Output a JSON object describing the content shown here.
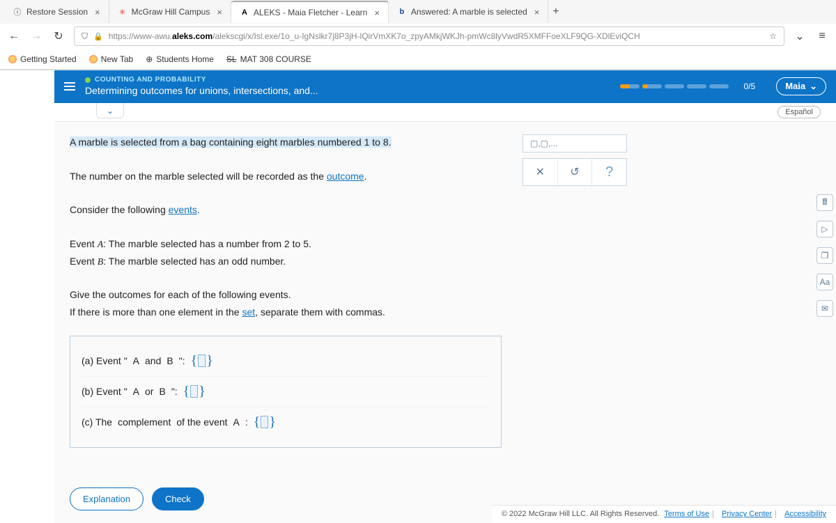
{
  "tabs": [
    {
      "label": "Restore Session",
      "icon": "ⓘ"
    },
    {
      "label": "McGraw Hill Campus",
      "icon": "✳"
    },
    {
      "label": "ALEKS - Maia Fletcher - Learn",
      "icon": "A",
      "active": true
    },
    {
      "label": "Answered: A marble is selected",
      "icon": "b"
    }
  ],
  "url": {
    "host_prefix": "https://www-awu.",
    "host_bold": "aleks.com",
    "path": "/alekscgi/x/Isl.exe/1o_u-IgNslkr7j8P3jH-lQirVmXK7o_zpyAMkjWKJh-pmWc8lyVwdR5XMFFoeXLF9QG-XDlEviQCH"
  },
  "bookmarks": [
    "Getting Started",
    "New Tab",
    "Students Home",
    "MAT 308 COURSE"
  ],
  "header": {
    "category": "COUNTING AND PROBABILITY",
    "title": "Determining outcomes for unions, intersections, and...",
    "progress_text": "0/5",
    "user": "Maia"
  },
  "lang": "Español",
  "problem": {
    "line1a": "A marble is selected from a bag containing eight marbles numbered ",
    "line1b": "1",
    "line1c": " to ",
    "line1d": "8",
    "line1e": ".",
    "line2a": "The number on the marble selected will be recorded as the ",
    "line2b": "outcome",
    "line2c": ".",
    "line3a": "Consider the following ",
    "line3b": "events",
    "line3c": ".",
    "evAa": "Event ",
    "evAb": "A",
    "evAc": ": The marble selected has a number from ",
    "evAd": "2",
    "evAe": " to ",
    "evAf": "5",
    "evAg": ".",
    "evBa": "Event ",
    "evBb": "B",
    "evBc": ": The marble selected has an odd number.",
    "inst1": "Give the outcomes for each of the following events.",
    "inst2a": "If there is more than one element in the ",
    "inst2b": "set",
    "inst2c": ", separate them with commas."
  },
  "answers": {
    "a_pre": "(a)  Event \"",
    "a_mid1": "A ",
    "a_op": "and",
    "a_mid2": " B",
    "a_post": "\":",
    "b_pre": "(b)  Event \"",
    "b_mid1": "A ",
    "b_op": "or",
    "b_mid2": " B",
    "b_post": "\":",
    "c_pre": "(c)  The ",
    "c_link": "complement",
    "c_mid": " of the event ",
    "c_ev": "A",
    "c_post": ":"
  },
  "tray_hint": "▢,▢,...",
  "tray": {
    "clear": "✕",
    "undo": "↺",
    "help": "?"
  },
  "right_tools": {
    "calc": "🖩",
    "play": "▷",
    "book": "❐",
    "font": "Aa",
    "mail": "✉"
  },
  "actions": {
    "explain": "Explanation",
    "check": "Check"
  },
  "legal": {
    "copy": "© 2022 McGraw Hill LLC. All Rights Reserved.",
    "terms": "Terms of Use",
    "privacy": "Privacy Center",
    "access": "Accessibility"
  }
}
